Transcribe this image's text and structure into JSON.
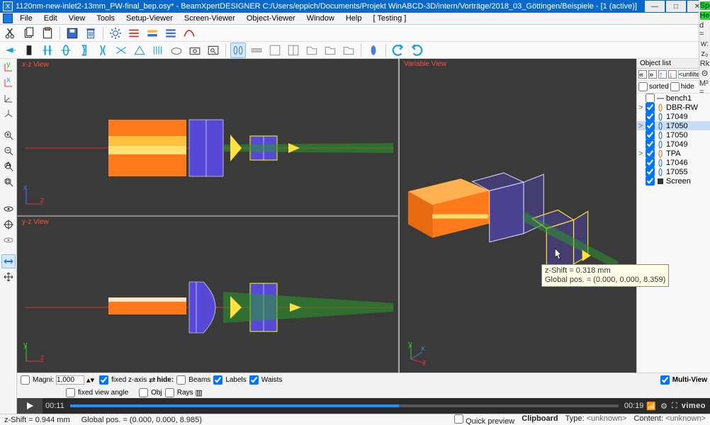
{
  "title": "1120nm-new-inlet2-13mm_PW-final_bep.osy* - BeamXpertDESIGNER C:/Users/eppich/Documents/Projekt WinABCD-3D/intern/Vorträge/2018_03_Göttingen/Beispiele - [1 (active)]",
  "menus": [
    "File",
    "Edit",
    "View",
    "Tools",
    "Setup-Viewer",
    "Screen-Viewer",
    "Object-Viewer",
    "Window",
    "Help",
    "[ Testing ]"
  ],
  "views": {
    "xz": "x-z View",
    "yz": "y-z View",
    "var": "Variable View"
  },
  "object_list": {
    "header": "Object list",
    "sorted": "sorted",
    "hide": "hide",
    "filter": "<unfilter",
    "items": [
      {
        "label": "bench1",
        "checked": false,
        "icon": "line",
        "hl": false
      },
      {
        "label": "DBR-RW",
        "checked": true,
        "icon": "lens-o",
        "hl": false,
        "expander": ">"
      },
      {
        "label": "17049",
        "checked": true,
        "icon": "lens-b",
        "hl": false
      },
      {
        "label": "17050",
        "checked": true,
        "icon": "lens-b",
        "hl": true,
        "expander": ">"
      },
      {
        "label": "17050",
        "checked": true,
        "icon": "lens-b",
        "hl": false
      },
      {
        "label": "17049",
        "checked": true,
        "icon": "lens-b",
        "hl": false
      },
      {
        "label": "TPA",
        "checked": true,
        "icon": "lens-o",
        "hl": false,
        "expander": ">"
      },
      {
        "label": "17046",
        "checked": true,
        "icon": "lens-b",
        "hl": false
      },
      {
        "label": "17055",
        "checked": true,
        "icon": "lens-b",
        "hl": false
      },
      {
        "label": "Screen",
        "checked": true,
        "icon": "screen",
        "hl": false
      }
    ]
  },
  "bottom": {
    "magni": "Magni:",
    "magni_val": "1,000",
    "fixed_z": "fixed z-axis",
    "fixed_angle": "fixed view angle",
    "hide": "hide:",
    "beams": "Beams",
    "labels": "Labels",
    "waists": "Waists",
    "obj": "Obj",
    "rays": "Rays",
    "multi": "Multi-View"
  },
  "play": {
    "t1": "00:11",
    "t2": "00:19",
    "brand": "vimeo"
  },
  "status": {
    "zshift": "z-Shift = 0.944 mm",
    "global": "Global pos. = (0.000, 0.000, 8.985)",
    "quick": "Quick preview",
    "clip": "Clipboard",
    "type": "Type:",
    "typev": "<unknown>",
    "content": "Content:",
    "contentv": "<unknown>"
  },
  "tooltip": {
    "l1": "z-Shift = 0.318 mm",
    "l2": "Global pos. = (0.000, 0.000, 8.359)"
  },
  "strip": {
    "sp": "Sp",
    "he": "He",
    "items": [
      "d =",
      "w:",
      "z₀",
      "Rk",
      "Θ",
      "M² ="
    ]
  }
}
